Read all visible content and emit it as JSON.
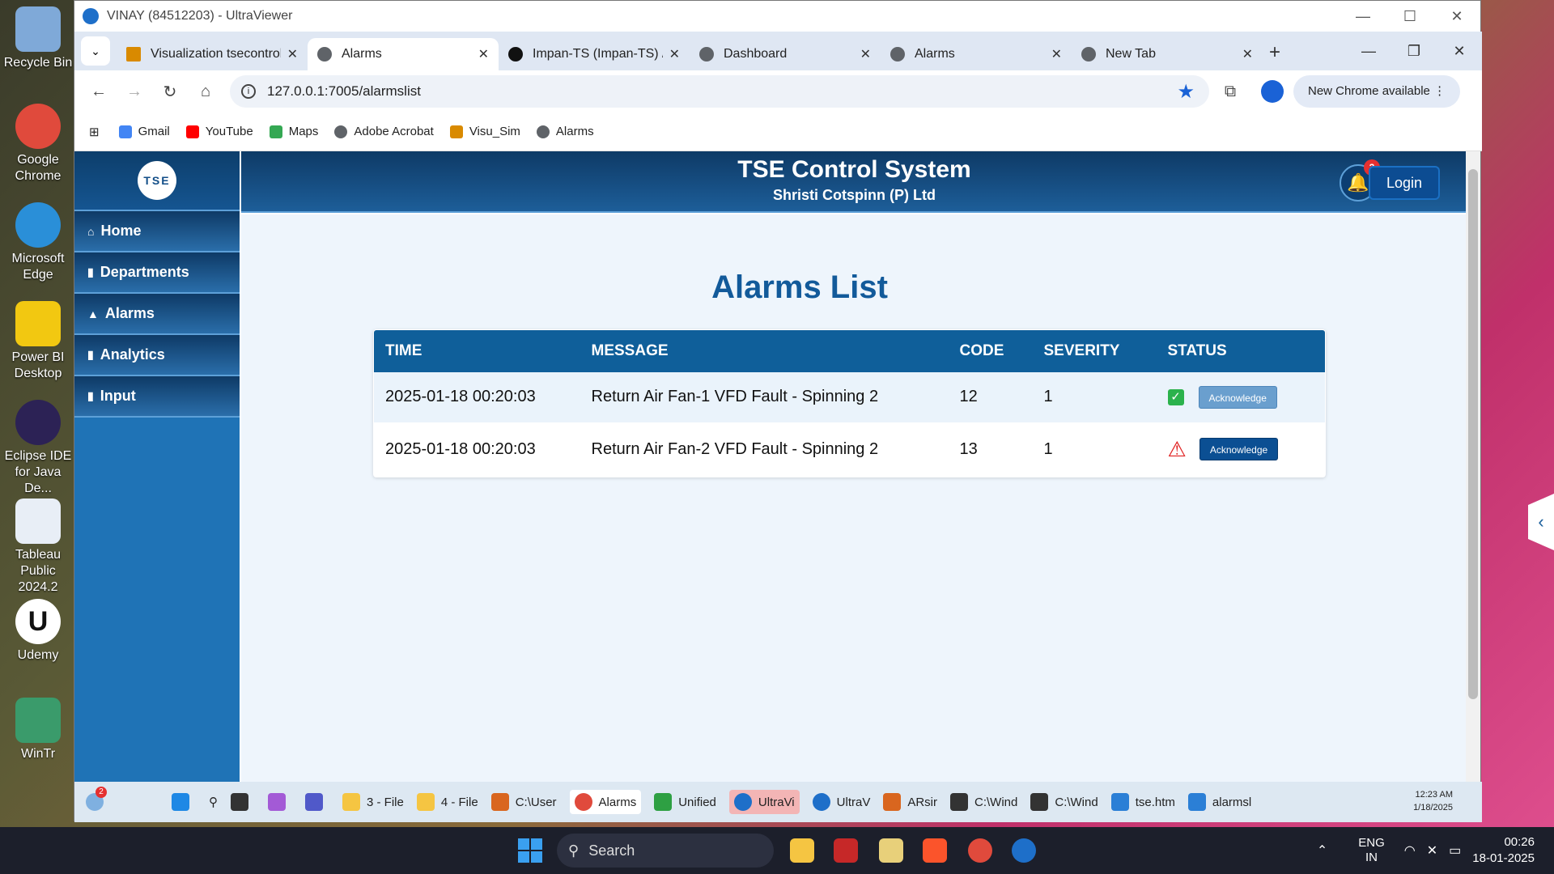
{
  "desktop": {
    "icons": [
      {
        "label": "Recycle Bin",
        "color": "#7fa9d8"
      },
      {
        "label": "Google Chrome",
        "color": "#e04a3c"
      },
      {
        "label": "Microsoft Edge",
        "color": "#2a8fd8"
      },
      {
        "label": "Power BI Desktop",
        "color": "#f2c811"
      },
      {
        "label": "Eclipse IDE for Java De...",
        "color": "#2c2255"
      },
      {
        "label": "Tableau Public 2024.2",
        "color": "#e8eef6"
      },
      {
        "label": "Udemy",
        "color": "#ffffff"
      },
      {
        "label": "WinTr",
        "color": "#3a9b6b"
      }
    ]
  },
  "remote_window": {
    "title": "VINAY (84512203) - UltraViewer",
    "controls": {
      "minimize": "—",
      "maximize": "☐",
      "close": "✕"
    }
  },
  "chrome": {
    "tabs_menu_icon": "chevron-down",
    "tabs": [
      {
        "title": "Visualization tsecontrol",
        "favicon": "tse",
        "active": false
      },
      {
        "title": "Alarms",
        "favicon": "globe",
        "active": true
      },
      {
        "title": "Impan-TS (Impan-TS) /",
        "favicon": "github",
        "active": false
      },
      {
        "title": "Dashboard",
        "favicon": "globe",
        "active": false
      },
      {
        "title": "Alarms",
        "favicon": "globe",
        "active": false
      },
      {
        "title": "New Tab",
        "favicon": "chrome",
        "active": false
      }
    ],
    "new_tab": "+",
    "url": "127.0.0.1:7005/alarmslist",
    "new_chrome_label": "New Chrome available",
    "bookmarks": [
      {
        "label": "Gmail",
        "color": "#4285f4"
      },
      {
        "label": "YouTube",
        "color": "#ff0000"
      },
      {
        "label": "Maps",
        "color": "#34a853"
      },
      {
        "label": "Adobe Acrobat",
        "color": "#5f6368"
      },
      {
        "label": "Visu_Sim",
        "color": "#d98a00"
      },
      {
        "label": "Alarms",
        "color": "#5f6368"
      }
    ]
  },
  "app": {
    "logo_text": "TSE",
    "title": "TSE Control System",
    "subtitle": "Shristi Cotspinn (P) Ltd",
    "notification_count": "2",
    "login_label": "Login",
    "sidebar": [
      {
        "label": "Home",
        "icon": "home"
      },
      {
        "label": "Departments",
        "icon": "document"
      },
      {
        "label": "Alarms",
        "icon": "warning"
      },
      {
        "label": "Analytics",
        "icon": "document"
      },
      {
        "label": "Input",
        "icon": "document"
      }
    ],
    "page_heading": "Alarms List",
    "table": {
      "columns": [
        "TIME",
        "MESSAGE",
        "CODE",
        "SEVERITY",
        "STATUS"
      ],
      "rows": [
        {
          "time": "2025-01-18 00:20:03",
          "message": "Return Air Fan-1 VFD Fault - Spinning 2",
          "code": "12",
          "severity": "1",
          "status": "acknowledged",
          "action": "Acknowledge"
        },
        {
          "time": "2025-01-18 00:20:03",
          "message": "Return Air Fan-2 VFD Fault - Spinning 2",
          "code": "13",
          "severity": "1",
          "status": "active",
          "action": "Acknowledge"
        }
      ]
    }
  },
  "remote_taskbar": {
    "badge": "2",
    "items": [
      {
        "label": "3 - File",
        "color": "#f5c542"
      },
      {
        "label": "4 - File",
        "color": "#f5c542"
      },
      {
        "label": "C:\\User",
        "color": "#d9661f"
      },
      {
        "label": "Alarms",
        "color": "#e04a3c"
      },
      {
        "label": "Unified",
        "color": "#2ea043"
      },
      {
        "label": "UltraVi",
        "color": "#1e6fc9"
      },
      {
        "label": "UltraV",
        "color": "#1e6fc9"
      },
      {
        "label": "ARsir",
        "color": "#d9661f"
      },
      {
        "label": "C:\\Wind",
        "color": "#333333"
      },
      {
        "label": "C:\\Wind",
        "color": "#333333"
      },
      {
        "label": "tse.htm",
        "color": "#2b7fd6"
      },
      {
        "label": "alarmsl",
        "color": "#2b7fd6"
      }
    ],
    "time": "12:23 AM",
    "date": "1/18/2025"
  },
  "local_taskbar": {
    "search_placeholder": "Search",
    "lang_line1": "ENG",
    "lang_line2": "IN",
    "time": "00:26",
    "date": "18-01-2025"
  }
}
